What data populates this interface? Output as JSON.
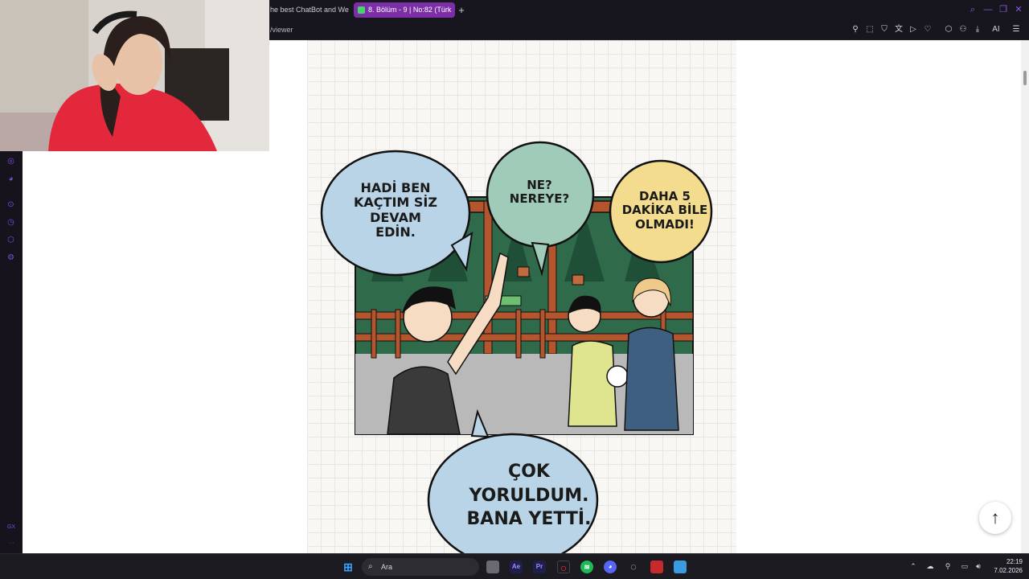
{
  "browser": {
    "tabs": [
      {
        "label": "he best ChatBot and We",
        "active": false
      },
      {
        "label": "8. Bölüm - 9 | No:82 (Türk",
        "active": true
      }
    ],
    "new_tab_label": "+",
    "address": "/viewer",
    "ai_label": "AI"
  },
  "sidebar": {
    "items": [
      "instagram-icon",
      "discord-icon",
      "player-icon",
      "history-icon",
      "extensions-icon",
      "settings-icon"
    ],
    "footer_label": "GX",
    "more_label": "···"
  },
  "comic": {
    "bubble_1": [
      "HADİ BEN",
      "KAÇTIM SİZ",
      "DEVAM",
      "EDİN."
    ],
    "bubble_2": [
      "NE?",
      "NEREYE?"
    ],
    "bubble_3": [
      "DAHA 5",
      "DAKİKA BİLE",
      "OLMADI!"
    ],
    "bubble_4": [
      "ÇOK",
      "YORULDUM.",
      "BANA YETTİ."
    ],
    "colors": {
      "blue_bubble": "#b9d4e6",
      "green_bubble": "#9fcbb8",
      "yellow_bubble": "#f3dc8e",
      "forest": "#2f6a4a",
      "fence": "#b4552d"
    }
  },
  "scroll_to_top": "↑",
  "taskbar": {
    "search_placeholder": "Ara",
    "time": "22:19",
    "date": "7.02.2026"
  }
}
